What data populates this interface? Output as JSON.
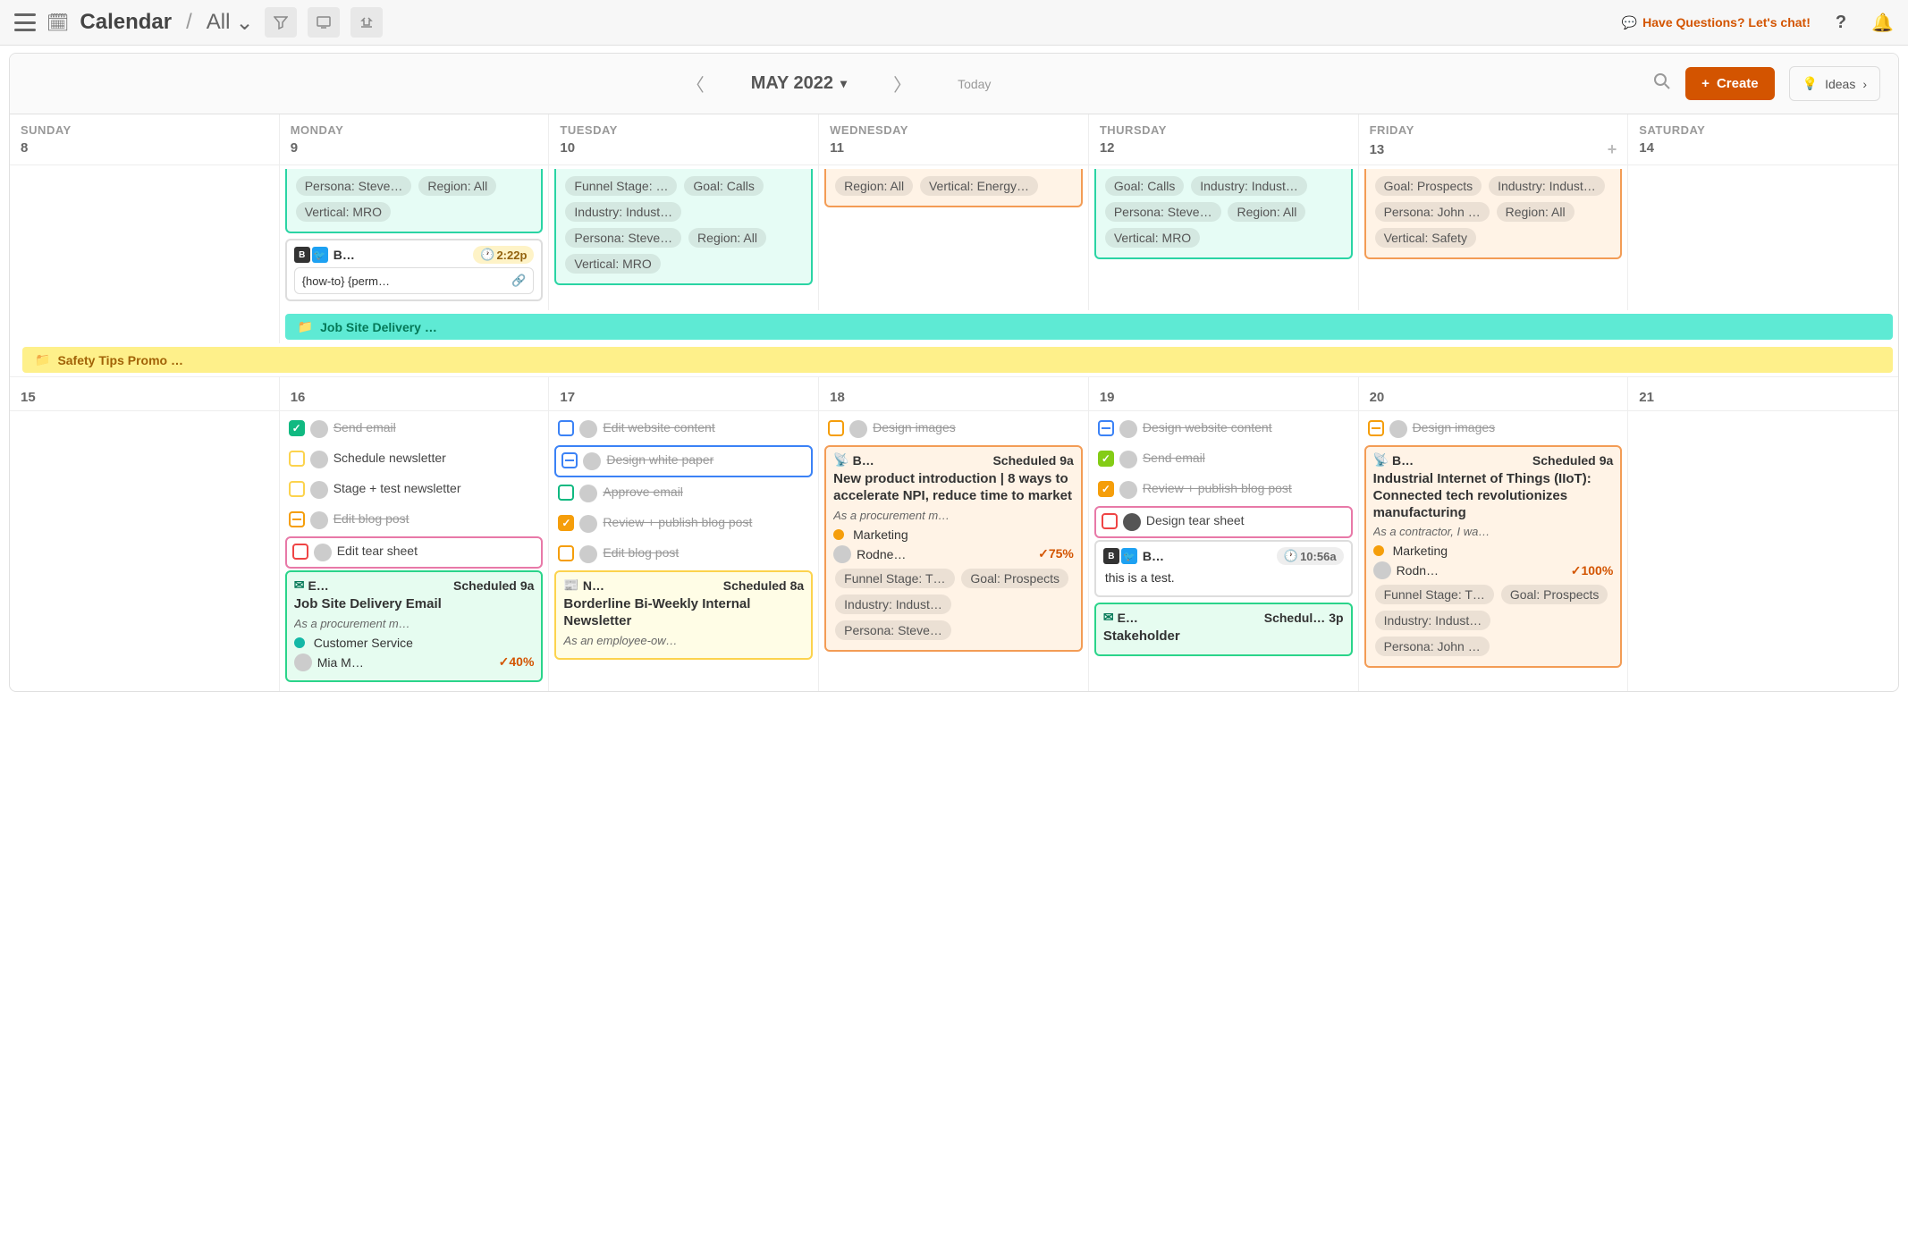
{
  "topbar": {
    "title": "Calendar",
    "view": "All",
    "chat_link": "Have Questions? Let's chat!"
  },
  "secondbar": {
    "month": "MAY 2022",
    "today": "Today",
    "create": "Create",
    "ideas": "Ideas"
  },
  "week1": {
    "headers": [
      {
        "name": "SUNDAY",
        "date": "8"
      },
      {
        "name": "MONDAY",
        "date": "9"
      },
      {
        "name": "TUESDAY",
        "date": "10"
      },
      {
        "name": "WEDNESDAY",
        "date": "11"
      },
      {
        "name": "THURSDAY",
        "date": "12"
      },
      {
        "name": "FRIDAY",
        "date": "13"
      },
      {
        "name": "SATURDAY",
        "date": "14"
      }
    ],
    "mon": {
      "tags": [
        "Persona: Steve…",
        "Region: All",
        "Vertical: MRO"
      ],
      "social_label": "B…",
      "social_time": "2:22p",
      "social_text": "{how-to} {perm…"
    },
    "tue": {
      "tags": [
        "Funnel Stage: …",
        "Goal: Calls",
        "Industry: Indust…",
        "Persona: Steve…",
        "Region: All",
        "Vertical: MRO"
      ]
    },
    "wed": {
      "tags": [
        "Region: All",
        "Vertical: Energy…"
      ]
    },
    "thu": {
      "tags": [
        "Goal: Calls",
        "Industry: Indust…",
        "Persona: Steve…",
        "Region: All",
        "Vertical: MRO"
      ]
    },
    "fri": {
      "tags": [
        "Goal: Prospects",
        "Industry: Indust…",
        "Persona: John …",
        "Region: All",
        "Vertical: Safety"
      ]
    },
    "banner1": "Job Site Delivery …",
    "banner2": "Safety Tips Promo …"
  },
  "week2": {
    "dates": [
      "15",
      "16",
      "17",
      "18",
      "19",
      "20",
      "21"
    ],
    "mon": {
      "tasks": [
        {
          "chk": "chk-green-done",
          "text": "Send email",
          "done": true,
          "icon": "✓"
        },
        {
          "chk": "chk-yellow",
          "text": "Schedule newsletter"
        },
        {
          "chk": "chk-yellow",
          "text": "Stage + test newsletter"
        },
        {
          "chk": "chk-orange-partial",
          "text": "Edit blog post",
          "done": true
        },
        {
          "chk": "chk-red",
          "text": "Edit tear sheet",
          "highlight": "highlight-pink"
        }
      ],
      "card": {
        "head_label": "E…",
        "sched": "Scheduled",
        "time": "9a",
        "title": "Job Site Delivery Email",
        "desc": "As a procurement m…",
        "cat": "Customer Service",
        "owner": "Mia M…",
        "pct": "40%"
      }
    },
    "tue": {
      "tasks": [
        {
          "chk": "chk-blue",
          "text": "Edit website content",
          "done": true
        },
        {
          "chk": "chk-blue-partial",
          "text": "Design white paper",
          "done": true,
          "highlight": "highlight-blue"
        },
        {
          "chk": "chk-green",
          "text": "Approve email",
          "done": true
        },
        {
          "chk": "chk-orange-done",
          "text": "Review + publish blog post",
          "done": true,
          "icon": "✓"
        },
        {
          "chk": "chk-orange",
          "text": "Edit blog post",
          "done": true
        }
      ],
      "card": {
        "head_label": "N…",
        "sched": "Scheduled",
        "time": "8a",
        "title": "Borderline Bi-Weekly Internal Newsletter",
        "desc": "As an employee-ow…"
      }
    },
    "wed": {
      "tasks": [
        {
          "chk": "chk-orange",
          "text": "Design images",
          "done": true
        }
      ],
      "card": {
        "head_label": "B…",
        "sched": "Scheduled",
        "time": "9a",
        "title": "New product introduction | 8 ways to accelerate NPI, reduce time to market",
        "desc": "As a procurement m…",
        "cat": "Marketing",
        "owner": "Rodne…",
        "pct": "75%",
        "tags": [
          "Funnel Stage: T…",
          "Goal: Prospects",
          "Industry: Indust…",
          "Persona: Steve…"
        ]
      }
    },
    "thu": {
      "tasks": [
        {
          "chk": "chk-blue-partial",
          "text": "Design website content",
          "done": true
        },
        {
          "chk": "chk-lime-done",
          "text": "Send email",
          "done": true,
          "icon": "✓"
        },
        {
          "chk": "chk-orange-done",
          "text": "Review + publish blog post",
          "done": true,
          "icon": "✓"
        },
        {
          "chk": "chk-red",
          "text": "Design tear sheet",
          "highlight": "highlight-pink",
          "dark": true
        }
      ],
      "social": {
        "label": "B…",
        "time": "10:56a",
        "text": "this is a test."
      },
      "card": {
        "head_label": "E…",
        "sched": "Schedul…",
        "time": "3p",
        "title": "Stakeholder"
      }
    },
    "fri": {
      "tasks": [
        {
          "chk": "chk-orange-partial",
          "text": "Design images",
          "done": true
        }
      ],
      "card": {
        "head_label": "B…",
        "sched": "Scheduled",
        "time": "9a",
        "title": "Industrial Internet of Things (IIoT): Connected tech revolutionizes manufacturing",
        "desc": "As a contractor, I wa…",
        "cat": "Marketing",
        "owner": "Rodn…",
        "pct": "100%",
        "tags": [
          "Funnel Stage: T…",
          "Goal: Prospects",
          "Industry: Indust…",
          "Persona: John …"
        ]
      }
    }
  }
}
